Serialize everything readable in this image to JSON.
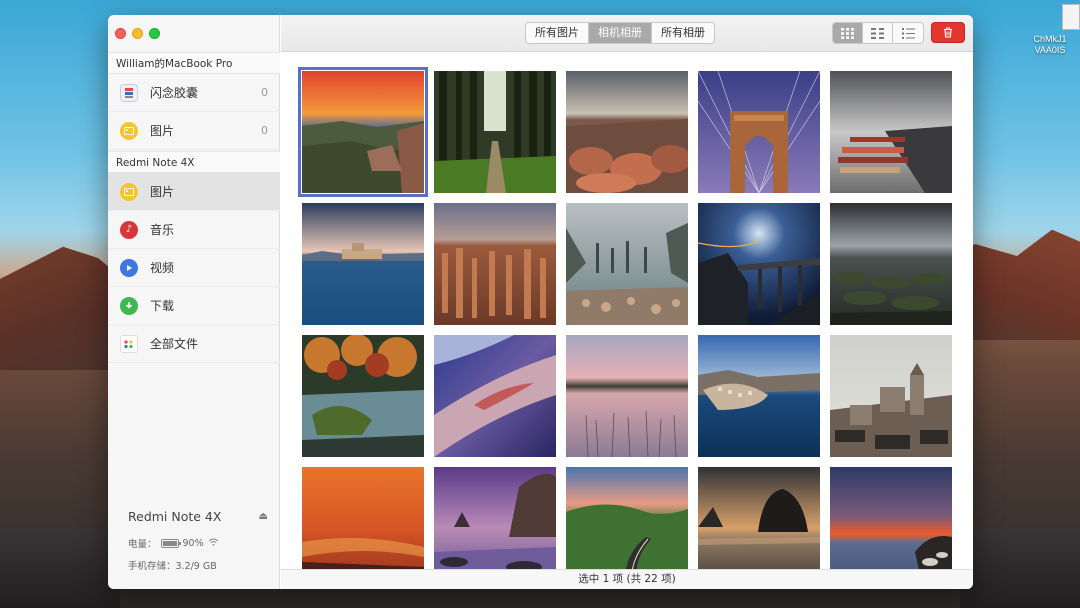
{
  "desktop": {
    "file_name_line1": "ChMkJ1",
    "file_name_line2": "VAA0IS"
  },
  "sidebar": {
    "mac_device": {
      "name": "William的MacBook Pro",
      "items": [
        {
          "label": "闪念胶囊",
          "count": "0",
          "icon": "capsule-icon"
        },
        {
          "label": "图片",
          "count": "0",
          "icon": "photo-icon"
        }
      ]
    },
    "phone_device": {
      "name": "Redmi Note 4X",
      "items": [
        {
          "label": "图片",
          "icon": "photo-icon",
          "color": "#f5c431"
        },
        {
          "label": "音乐",
          "icon": "music-icon",
          "color": "#d8373a"
        },
        {
          "label": "视频",
          "icon": "video-icon",
          "color": "#3c78e0"
        },
        {
          "label": "下载",
          "icon": "download-icon",
          "color": "#3fb94f"
        },
        {
          "label": "全部文件",
          "icon": "all-files-icon"
        }
      ]
    },
    "footer": {
      "device_name": "Redmi Note 4X",
      "battery_label": "电量：",
      "battery_value": "90%",
      "battery_level": 0.9,
      "storage": "手机存储：3.2/9 GB"
    }
  },
  "toolbar": {
    "tabs": [
      "所有图片",
      "相机相册",
      "所有相册"
    ],
    "active_tab": 1,
    "view_modes": [
      "large-grid-icon",
      "medium-grid-icon",
      "list-grid-icon"
    ],
    "active_view": 0,
    "delete_icon": "trash-icon",
    "delete_color": "#e2362f"
  },
  "status": {
    "text": "选中 1 项 (共 22 项)"
  },
  "colors": {
    "selection_outline": "#5a6fc8"
  }
}
